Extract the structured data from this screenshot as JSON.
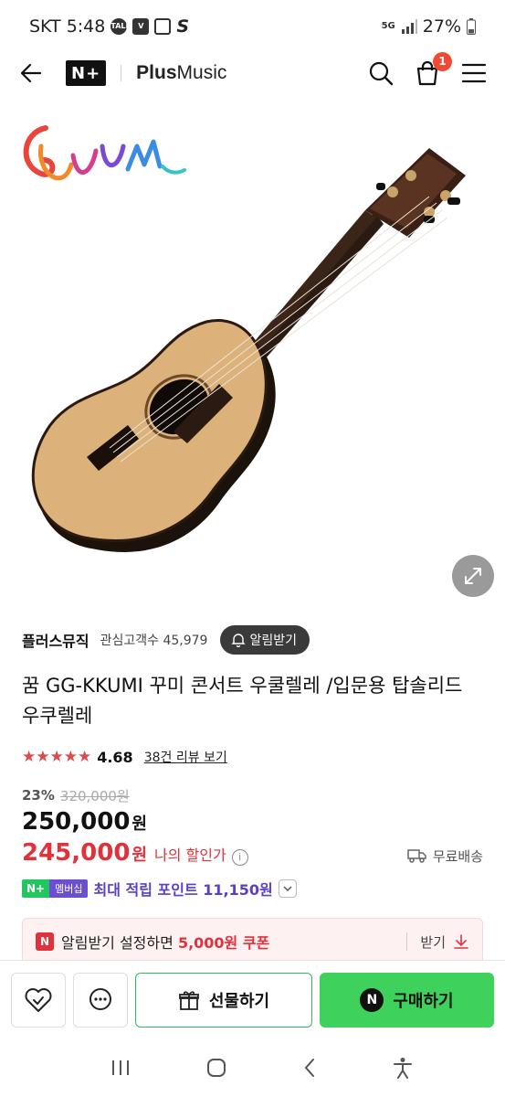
{
  "status_bar": {
    "carrier_time": "SKT 5:48",
    "network": "5G",
    "battery": "27%"
  },
  "header": {
    "logo": "N+",
    "store_name_bold": "Plus",
    "store_name_rest": "Music",
    "cart_count": "1"
  },
  "seller": {
    "name": "플러스뮤직",
    "fans": "관심고객수 45,979",
    "alert_label": "알림받기"
  },
  "product": {
    "title": "꿈 GG-KKUMI 꾸미 콘서트 우쿨렐레 /입문용 탑솔리드 우쿠렐레",
    "stars": "★★★★★",
    "rating": 4.68,
    "rating_text": "4.68",
    "review_link": "38건 리뷰 보기",
    "discount": "23%",
    "original_price": "320,000원",
    "price": "250,000",
    "price_unit": "원",
    "my_price": "245,000",
    "my_price_unit": "원",
    "my_price_label": "나의 할인가",
    "shipping": "무료배송"
  },
  "points": {
    "badge_np": "N+",
    "badge_member": "멤버십",
    "text": "최대 적립 포인트 11,150원"
  },
  "coupon": {
    "badge": "N",
    "text_prefix": "알림받기 설정하면 ",
    "text_highlight": "5,000원 쿠폰",
    "download_label": "받기"
  },
  "actions": {
    "gift_label": "선물하기",
    "buy_label": "구매하기",
    "buy_badge": "N"
  },
  "colors": {
    "accent_green": "#3ed15b",
    "price_red": "#e0323c",
    "membership_purple": "#6b4fd0",
    "badge_red": "#f24a32"
  }
}
